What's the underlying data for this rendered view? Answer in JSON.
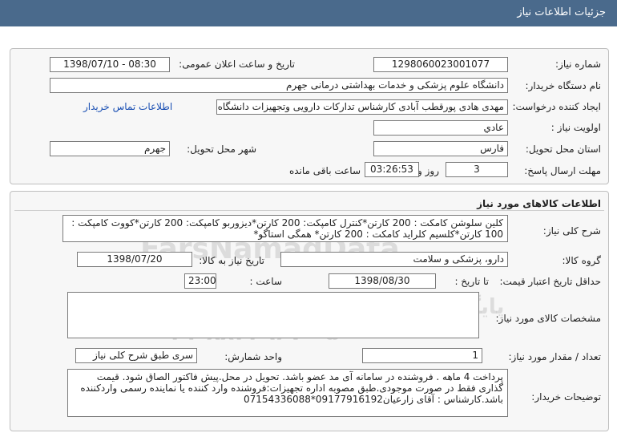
{
  "header": {
    "title": "جزئیات اطلاعات نیاز"
  },
  "info": {
    "need_number_label": "شماره نیاز:",
    "need_number": "1298060023001077",
    "announce_label": "تاریخ و ساعت اعلان عمومی:",
    "announce_value": "1398/07/10 - 08:30",
    "buyer_org_label": "نام دستگاه خریدار:",
    "buyer_org": "دانشگاه علوم پزشکی و خدمات بهداشتی درمانی جهرم",
    "creator_label": "ایجاد کننده درخواست:",
    "creator": "مهدی هادی پورقطب آبادی کارشناس تدارکات دارویی وتجهیزات دانشگاه علوم پز",
    "contact_link": "اطلاعات تماس خریدار",
    "priority_label": "اولویت نیاز :",
    "priority": "عادي",
    "province_label": "استان محل تحویل:",
    "province": "فارس",
    "city_label": "شهر محل تحویل:",
    "city": "جهرم",
    "deadline_label": "مهلت ارسال پاسخ:",
    "days": "3",
    "days_word": "روز و",
    "time_left": "03:26:53",
    "remaining_word": "ساعت باقی مانده"
  },
  "goods": {
    "section_title": "اطلاعات کالاهای مورد نیاز",
    "summary_label": "شرح کلی نیاز:",
    "summary": "کلین سلوشن کامکت : 200 کارتن*کنترل کامپکت: 200 کارتن*دیزوربو کامپکت: 200 کارتن*کووت کامپکت : 100 کارتن*کلسیم کلراید کامکت : 200 کارتن* همگی استاگو*",
    "group_label": "گروه کالا:",
    "group": "دارو، پزشکی و سلامت",
    "need_date_label": "تاریخ نیاز به کالا:",
    "need_date": "1398/07/20",
    "validity_label": "حداقل تاریخ اعتبار قیمت:",
    "until_date_label": "تا تاریخ :",
    "validity_date": "1398/08/30",
    "hour_label": "ساعت :",
    "validity_time": "23:00",
    "specs_label": "مشخصات کالای مورد نیاز:",
    "specs": "",
    "qty_label": "تعداد / مقدار مورد نیاز:",
    "qty": "1",
    "unit_label": "واحد شمارش:",
    "unit": "سری طبق شرح کلی نیاز",
    "buyer_notes_label": "توضیحات خریدار:",
    "buyer_notes": "پرداخت 4 ماهه . فروشنده در سامانه آی مد عضو باشد. تحویل در محل.پیش فاکتور الصاق شود. قیمت گذاری فقط در صورت موجودی.طبق مصوبه اداره تجهیزات:فروشنده وارد کننده یا نماینده رسمی واردکننده باشد.کارشناس : آقای زارعیان09177916192*07154336088"
  },
  "watermark": {
    "line1": "FarsNamadData",
    "line2": "پایگاه اطلاع رسانی مناقصه و مزایده",
    "line3": "۰۲۱-۸۸۳۴۹۶۷۰-۵"
  },
  "colors": {
    "header_bg": "#4a6a8c",
    "link": "#1a4fb3"
  }
}
